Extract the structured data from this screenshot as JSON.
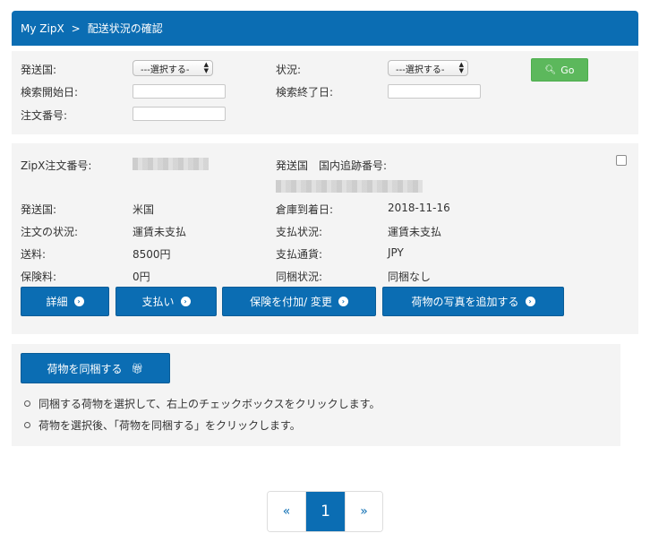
{
  "breadcrumb": {
    "home": "My ZipX",
    "separator": ">",
    "current": "配送状況の確認"
  },
  "search": {
    "country_label": "発送国:",
    "country_select": "---選択する-",
    "status_label": "状況:",
    "status_select": "---選択する-",
    "start_date_label": "検索開始日:",
    "end_date_label": "検索終了日:",
    "order_no_label": "注文番号:",
    "go_label": "Go"
  },
  "order": {
    "zipx_order_label": "ZipX注文番号:",
    "tracking_label": "発送国　国内追跡番号:",
    "country_label": "発送国:",
    "country_value": "米国",
    "warehouse_label": "倉庫到着日:",
    "warehouse_value": "2018-11-16",
    "order_status_label": "注文の状況:",
    "order_status_value": "運賃未支払",
    "payment_status_label": "支払状況:",
    "payment_status_value": "運賃未支払",
    "shipping_label": "送料:",
    "shipping_value": "8500円",
    "currency_label": "支払通貨:",
    "currency_value": "JPY",
    "insurance_label": "保険料:",
    "insurance_value": "0円",
    "bundle_label": "同梱状況:",
    "bundle_value": "同梱なし",
    "buttons": {
      "details": "詳細",
      "pay": "支払い",
      "insurance": "保険を付加/ 変更",
      "photo": "荷物の写真を追加する"
    }
  },
  "combine": {
    "button": "荷物を同梱する",
    "notes": [
      "同梱する荷物を選択して、右上のチェックボックスをクリックします。",
      "荷物を選択後、「荷物を同梱する」をクリックします。"
    ]
  },
  "pagination": {
    "prev": "«",
    "current": "1",
    "next": "»"
  },
  "colors": {
    "primary": "#0b6db3",
    "go": "#5cb85c",
    "panel": "#f4f4f4"
  }
}
